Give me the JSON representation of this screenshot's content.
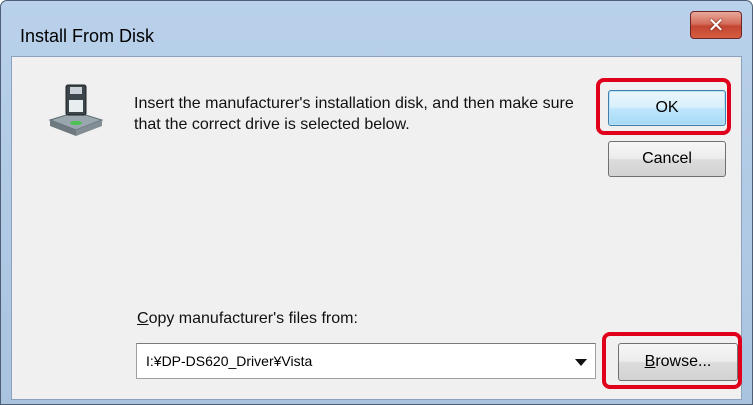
{
  "window": {
    "title": "Install From Disk",
    "close_glyph": "✕"
  },
  "message": "Insert the manufacturer's installation disk, and then make sure that the correct drive is selected below.",
  "buttons": {
    "ok": "OK",
    "cancel": "Cancel",
    "browse_prefix": "",
    "browse_mnemonic": "B",
    "browse_rest": "rowse..."
  },
  "copy_from": {
    "label_mnemonic": "C",
    "label_rest": "opy manufacturer's files from:",
    "value": "I:¥DP-DS620_Driver¥Vista"
  },
  "icons": {
    "disk": "floppy-drive-icon",
    "dropdown": "chevron-down-icon",
    "close": "close-icon"
  },
  "colors": {
    "highlight": "#e0001b",
    "default_button": "#bee6fd"
  }
}
